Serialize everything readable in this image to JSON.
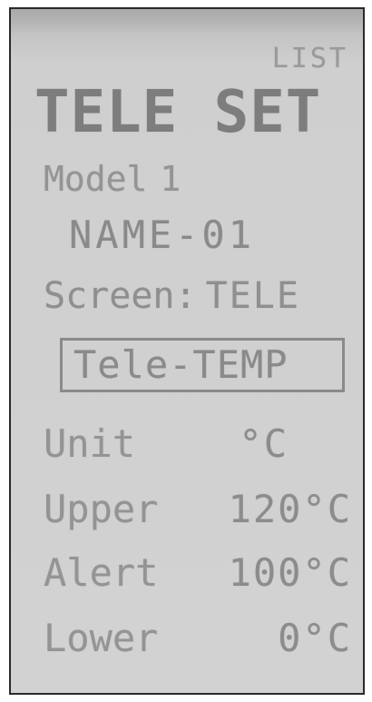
{
  "header": {
    "list_label": "LIST",
    "title": "TELE SET"
  },
  "model": {
    "label": "Model",
    "number": "1",
    "name": "NAME-01"
  },
  "screen": {
    "label": "Screen:",
    "value": "TELE"
  },
  "selected_item": "Tele-TEMP",
  "settings": [
    {
      "label": "Unit",
      "value": "°C"
    },
    {
      "label": "Upper",
      "value": "120°C"
    },
    {
      "label": "Alert",
      "value": "100°C"
    },
    {
      "label": "Lower",
      "value": "0°C"
    }
  ],
  "colors": {
    "lcd_background": "#d2d2d2",
    "pixel_text": "#8f8f8f",
    "frame": "#2a2a2a"
  }
}
